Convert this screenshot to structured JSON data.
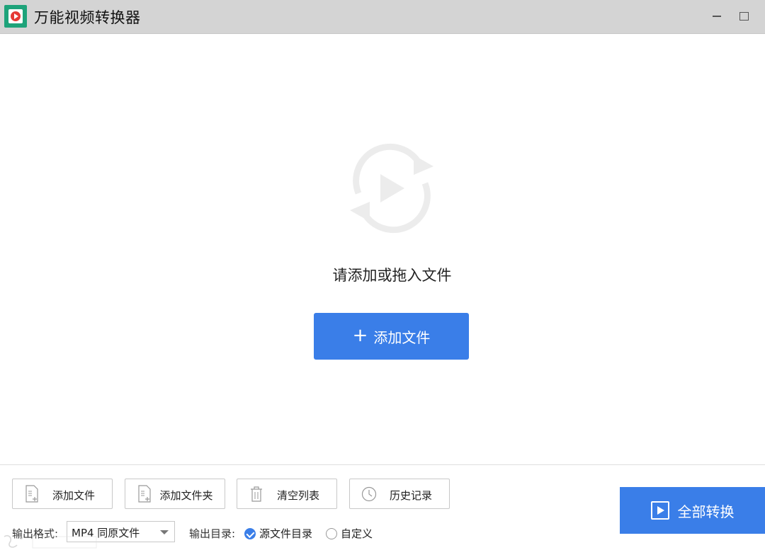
{
  "window": {
    "title": "万能视频转换器",
    "minimize_icon": "minimize-icon",
    "maximize_icon": "maximize-icon"
  },
  "dropzone": {
    "prompt": "请添加或拖入文件",
    "add_button_plus": "+",
    "add_button_label": "添加文件"
  },
  "toolbar": {
    "add_file": "添加文件",
    "add_folder": "添加文件夹",
    "clear_list": "清空列表",
    "history": "历史记录"
  },
  "output": {
    "format_label": "输出格式:",
    "format_value": "MP4 同原文件",
    "dir_label": "输出目录:",
    "dir_options": [
      {
        "label": "源文件目录",
        "selected": true
      },
      {
        "label": "自定义",
        "selected": false
      }
    ]
  },
  "convert_all_label": "全部转换",
  "colors": {
    "accent": "#3a7ee8",
    "titlebar": "#d4d4d4",
    "app_icon_bg": "#1ea37a",
    "app_icon_dot": "#e53935"
  }
}
